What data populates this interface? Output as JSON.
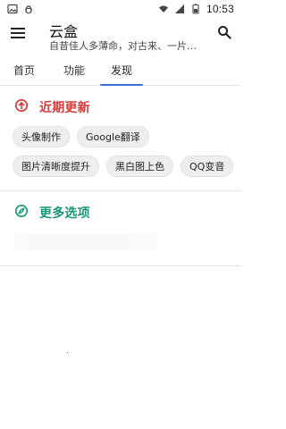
{
  "status_bar": {
    "left_icons": [
      "image-icon",
      "bug-icon"
    ],
    "time": "10:53",
    "right_icons": [
      "wifi-icon",
      "signal-icon",
      "battery-icon"
    ]
  },
  "app_bar": {
    "title": "云盒",
    "subtitle": "自昔佳人多薄命，对古来、一片伤…",
    "menu_icon": "menu-icon",
    "search_icon": "search-icon"
  },
  "tabs": [
    {
      "label": "首页",
      "active": false
    },
    {
      "label": "功能",
      "active": false
    },
    {
      "label": "发现",
      "active": true
    }
  ],
  "sections": {
    "recent": {
      "title": "近期更新",
      "icon": "arrow-up-circle-icon",
      "color": "#d93b3b",
      "chips": [
        [
          "头像制作",
          "Google翻译"
        ],
        [
          "图片清晰度提升",
          "黑白图上色",
          "QQ变音"
        ]
      ]
    },
    "more": {
      "title": "更多选项",
      "icon": "compass-icon",
      "color": "#169a7a"
    }
  },
  "accent": "#3f73d8"
}
